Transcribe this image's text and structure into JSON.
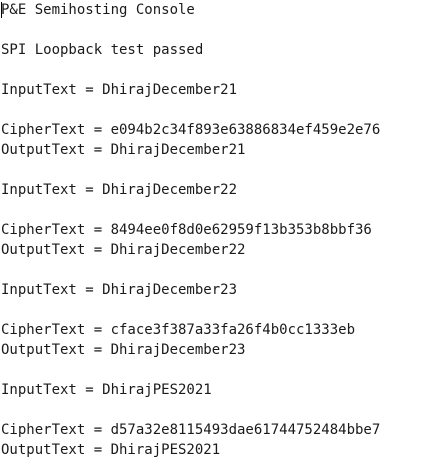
{
  "console": {
    "title": "P&E Semihosting Console",
    "status": "SPI Loopback test passed",
    "records": [
      {
        "input": "InputText = DhirajDecember21",
        "cipher": "CipherText = e094b2c34f893e63886834ef459e2e76",
        "output": "OutputText = DhirajDecember21"
      },
      {
        "input": "InputText = DhirajDecember22",
        "cipher": "CipherText = 8494ee0f8d0e62959f13b353b8bbf36",
        "output": "OutputText = DhirajDecember22"
      },
      {
        "input": "InputText = DhirajDecember23",
        "cipher": "CipherText = cface3f387a33fa26f4b0cc1333eb",
        "output": "OutputText = DhirajDecember23"
      },
      {
        "input": "InputText = DhirajPES2021",
        "cipher": "CipherText = d57a32e8115493dae61744752484bbe7",
        "output": "OutputText = DhirajPES2021"
      }
    ]
  }
}
